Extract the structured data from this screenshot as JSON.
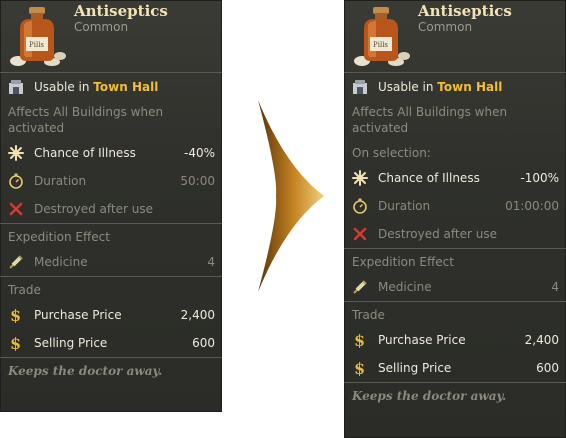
{
  "left": {
    "title": "Antiseptics",
    "rarity": "Common",
    "usable_prefix": "Usable in ",
    "usable_place": "Town Hall",
    "affects": "Affects All Buildings when activated",
    "stats": [
      {
        "label": "Chance of Illness",
        "value": "-40%"
      },
      {
        "label": "Duration",
        "value": "50:00"
      },
      {
        "label": "Destroyed after use",
        "value": ""
      }
    ],
    "expedition_title": "Expedition Effect",
    "expedition": {
      "label": "Medicine",
      "value": "4"
    },
    "trade_title": "Trade",
    "purchase": {
      "label": "Purchase Price",
      "value": "2,400"
    },
    "selling": {
      "label": "Selling Price",
      "value": "600"
    },
    "flavor": "Keeps the doctor away."
  },
  "right": {
    "title": "Antiseptics",
    "rarity": "Common",
    "usable_prefix": "Usable in ",
    "usable_place": "Town Hall",
    "affects": "Affects All Buildings when activated",
    "on_selection": "On selection:",
    "stats": [
      {
        "label": "Chance of Illness",
        "value": "-100%"
      },
      {
        "label": "Duration",
        "value": "01:00:00"
      },
      {
        "label": "Destroyed after use",
        "value": ""
      }
    ],
    "expedition_title": "Expedition Effect",
    "expedition": {
      "label": "Medicine",
      "value": "4"
    },
    "trade_title": "Trade",
    "purchase": {
      "label": "Purchase Price",
      "value": "2,400"
    },
    "selling": {
      "label": "Selling Price",
      "value": "600"
    },
    "flavor": "Keeps the doctor away."
  },
  "icons": {
    "item": "antiseptic-bottle-icon",
    "building": "town-hall-icon",
    "illness": "illness-icon",
    "duration": "stopwatch-icon",
    "destroyed": "red-x-icon",
    "medicine": "medicine-syringe-icon",
    "money": "dollar-icon",
    "arrow": "right-arrow"
  },
  "colors": {
    "panel_bg": "#2f302b",
    "title": "#f3e2b6",
    "highlight_gold": "#f2be3a",
    "arrow": "#a5671b"
  }
}
